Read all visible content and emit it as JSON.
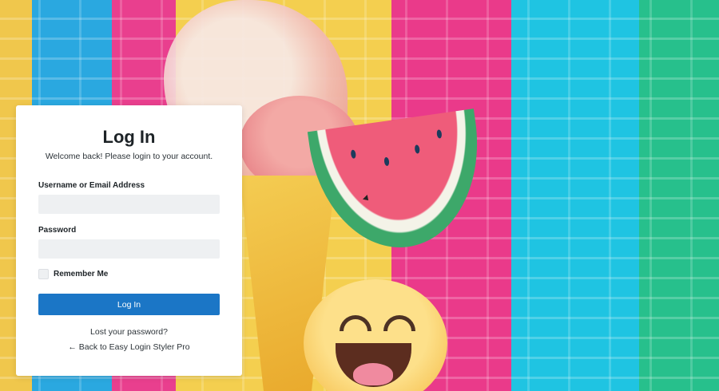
{
  "login": {
    "title": "Log In",
    "subtitle": "Welcome back! Please login to your account.",
    "username_label": "Username or Email Address",
    "username_value": "",
    "password_label": "Password",
    "password_value": "",
    "remember_label": "Remember Me",
    "remember_checked": false,
    "submit_label": "Log In",
    "lost_password_link": "Lost your password?",
    "back_link": "← Back to Easy Login Styler Pro"
  },
  "colors": {
    "button": "#1b76c6",
    "input_bg": "#eef0f2",
    "card_bg": "#ffffff"
  }
}
